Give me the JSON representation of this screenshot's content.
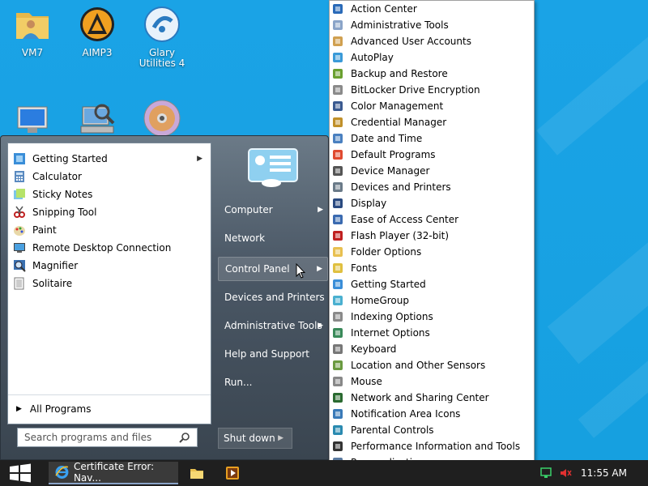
{
  "desktop": {
    "icons": [
      {
        "label": "VM7",
        "icon": "user-folder-icon"
      },
      {
        "label": "AIMP3",
        "icon": "aimp-icon"
      },
      {
        "label": "Glary Utilities 4",
        "icon": "glary-icon"
      },
      {
        "label": "",
        "icon": "computer-icon"
      },
      {
        "label": "",
        "icon": "search-computer-icon"
      },
      {
        "label": "",
        "icon": "disc-icon"
      }
    ]
  },
  "start_menu": {
    "programs": [
      {
        "label": "Getting Started",
        "icon": "getting-started-icon",
        "has_submenu": true
      },
      {
        "label": "Calculator",
        "icon": "calculator-icon",
        "has_submenu": false
      },
      {
        "label": "Sticky Notes",
        "icon": "sticky-notes-icon",
        "has_submenu": false
      },
      {
        "label": "Snipping Tool",
        "icon": "snipping-tool-icon",
        "has_submenu": false
      },
      {
        "label": "Paint",
        "icon": "paint-icon",
        "has_submenu": false
      },
      {
        "label": "Remote Desktop Connection",
        "icon": "remote-desktop-icon",
        "has_submenu": false
      },
      {
        "label": "Magnifier",
        "icon": "magnifier-icon",
        "has_submenu": false
      },
      {
        "label": "Solitaire",
        "icon": "solitaire-icon",
        "has_submenu": false
      }
    ],
    "all_programs": "All Programs",
    "search_placeholder": "Search programs and files",
    "right_items": [
      {
        "label": "Computer",
        "has_submenu": true
      },
      {
        "label": "Network",
        "has_submenu": false
      },
      {
        "label": "Control Panel",
        "has_submenu": true,
        "highlighted": true
      },
      {
        "label": "Devices and Printers",
        "has_submenu": false
      },
      {
        "label": "Administrative Tools",
        "has_submenu": true
      },
      {
        "label": "Help and Support",
        "has_submenu": false
      },
      {
        "label": "Run...",
        "has_submenu": false
      }
    ],
    "shutdown": "Shut down"
  },
  "control_panel_menu": {
    "items": [
      "Action Center",
      "Administrative Tools",
      "Advanced User Accounts",
      "AutoPlay",
      "Backup and Restore",
      "BitLocker Drive Encryption",
      "Color Management",
      "Credential Manager",
      "Date and Time",
      "Default Programs",
      "Device Manager",
      "Devices and Printers",
      "Display",
      "Ease of Access Center",
      "Flash Player (32-bit)",
      "Folder Options",
      "Fonts",
      "Getting Started",
      "HomeGroup",
      "Indexing Options",
      "Internet Options",
      "Keyboard",
      "Location and Other Sensors",
      "Mouse",
      "Network and Sharing Center",
      "Notification Area Icons",
      "Parental Controls",
      "Performance Information and Tools",
      "Personalization"
    ]
  },
  "taskbar": {
    "active_window": "Certificate Error: Nav...",
    "clock": "11:55 AM"
  },
  "colors": {
    "desktop": "#1ba1e2",
    "taskbar": "#1f1f1f",
    "start_menu": "#4b5866"
  }
}
